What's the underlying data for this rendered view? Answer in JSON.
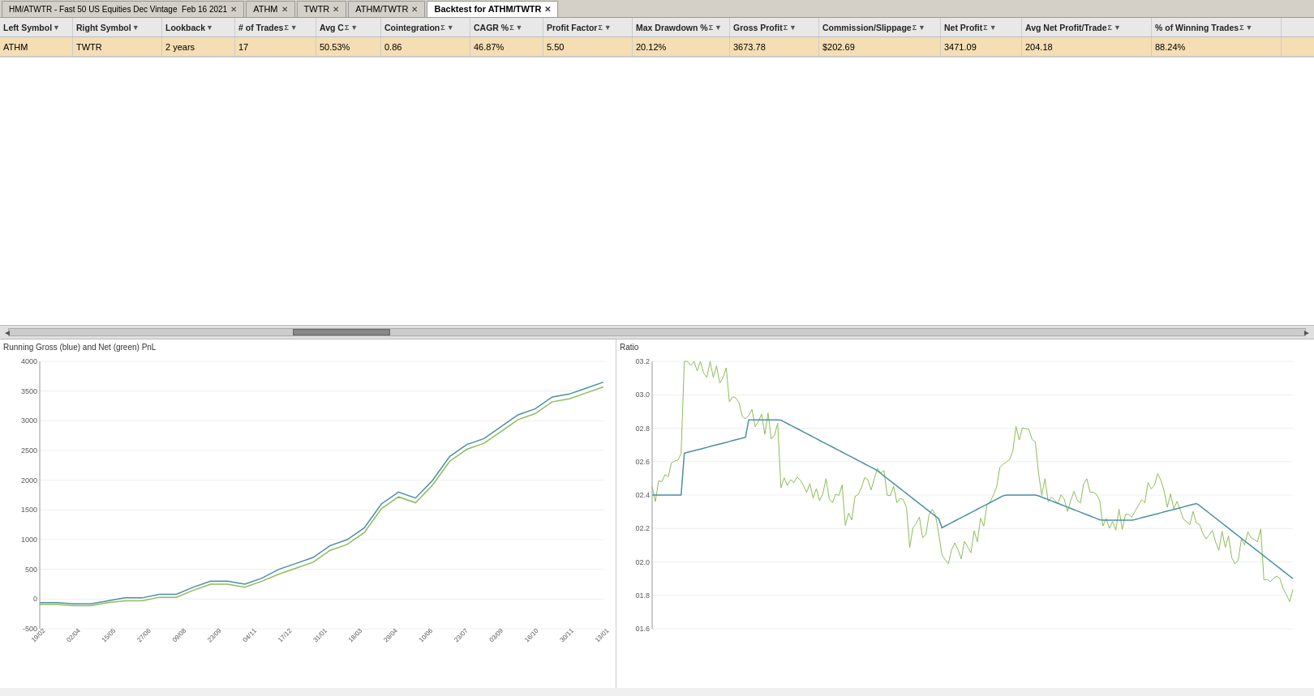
{
  "tabs": [
    {
      "label": "HM/ATWTR - Fast 50 US Equities Dec Vintage  Feb 16 2021",
      "active": false,
      "closable": true
    },
    {
      "label": "ATHM",
      "active": false,
      "closable": true
    },
    {
      "label": "TWTR",
      "active": false,
      "closable": true
    },
    {
      "label": "ATHM/TWTR",
      "active": false,
      "closable": true
    },
    {
      "label": "Backtest for ATHM/TWTR",
      "active": true,
      "closable": true
    }
  ],
  "table": {
    "headers": [
      {
        "label": "Left Symbol",
        "sort": true,
        "sigma": false,
        "col": "col-left"
      },
      {
        "label": "Right Symbol",
        "sort": true,
        "sigma": false,
        "col": "col-right"
      },
      {
        "label": "Lookback",
        "sort": true,
        "sigma": false,
        "col": "col-lookback"
      },
      {
        "label": "# of Trades",
        "sort": true,
        "sigma": true,
        "col": "col-trades"
      },
      {
        "label": "Avg C",
        "sort": true,
        "sigma": true,
        "col": "col-avgc"
      },
      {
        "label": "Cointegration",
        "sort": true,
        "sigma": true,
        "col": "col-coint"
      },
      {
        "label": "CAGR %",
        "sort": true,
        "sigma": true,
        "col": "col-cagr"
      },
      {
        "label": "Profit Factor",
        "sort": true,
        "sigma": true,
        "col": "col-pf"
      },
      {
        "label": "Max Drawdown %",
        "sort": true,
        "sigma": true,
        "col": "col-mdd"
      },
      {
        "label": "Gross Profit",
        "sort": true,
        "sigma": true,
        "col": "col-gp"
      },
      {
        "label": "Commission/Slippage",
        "sort": true,
        "sigma": true,
        "col": "col-cs"
      },
      {
        "label": "Net Profit",
        "sort": true,
        "sigma": true,
        "col": "col-np"
      },
      {
        "label": "Avg Net Profit/Trade",
        "sort": true,
        "sigma": true,
        "col": "col-anpt"
      },
      {
        "label": "% of Winning Trades",
        "sort": true,
        "sigma": true,
        "col": "col-pwin"
      }
    ],
    "rows": [
      {
        "left_symbol": "ATHM",
        "right_symbol": "TWTR",
        "lookback": "2 years",
        "trades": "17",
        "avg_c": "50.53%",
        "cointegration": "0.86",
        "cagr": "46.87%",
        "profit_factor": "5.50",
        "max_drawdown": "20.12%",
        "gross_profit": "3673.78",
        "commission": "$202.69",
        "net_profit": "3471.09",
        "avg_net_profit": "204.18",
        "pct_winning": "88.24%"
      }
    ]
  },
  "charts": {
    "left": {
      "title": "Running Gross (blue) and Net (green) PnL",
      "y_axis": [
        "4000",
        "3500",
        "3000",
        "2500",
        "2000",
        "1500",
        "1000",
        "500",
        "00",
        "-500"
      ],
      "x_axis": [
        "19/02/2019",
        "02/04/2019",
        "15/05/2019",
        "27/06/2019",
        "09/08/2019",
        "23/09/2019",
        "04/11/2019",
        "17/12/2019",
        "31/01/2020",
        "18/03/2020",
        "29/04/2020",
        "10/06/2020",
        "23/07/2020",
        "03/09/2020",
        "16/10/2020",
        "30/11/2020",
        "13/01/2021"
      ]
    },
    "right": {
      "title": "Ratio",
      "y_axis": [
        "03.2",
        "03",
        "02.8",
        "02.6",
        "02.4",
        "02.2",
        "02",
        "01.8",
        "01.6"
      ]
    }
  }
}
